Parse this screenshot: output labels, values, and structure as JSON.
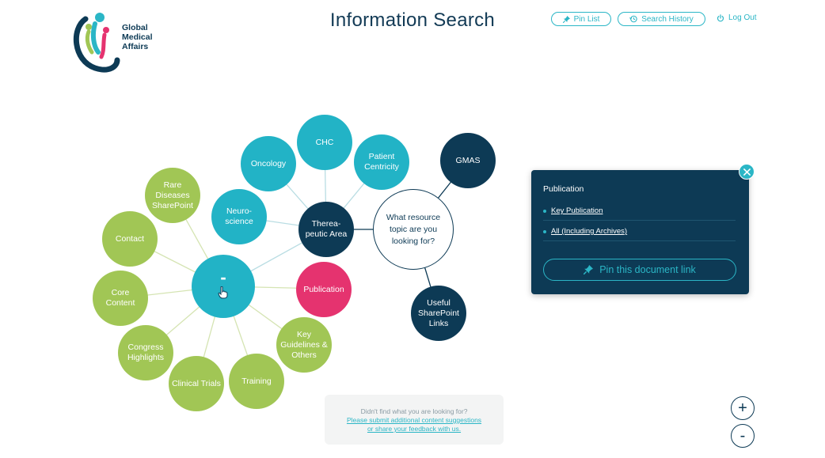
{
  "header": {
    "title": "Information Search",
    "logo_lines": [
      "Global",
      "Medical",
      "Affairs"
    ],
    "pin_list_label": "Pin List",
    "search_history_label": "Search History",
    "logout_label": "Log Out"
  },
  "mindmap": {
    "center_question": "What resource topic are you looking for?",
    "active_node_label": "-",
    "nodes": {
      "gmas": "GMAS",
      "useful_sharepoint": "Useful SharePoint Links",
      "therapeutic_area": "Therea-peutic Area",
      "chc": "CHC",
      "oncology": "Oncology",
      "patient_centricity": "Patient Centricity",
      "neuroscience": "Neuro-science",
      "publication": "Publication",
      "key_guidelines": "Key Guidelines & Others",
      "training": "Training",
      "clinical_trials": "Clinical Trials",
      "congress_highlights": "Congress Highlights",
      "core_content": "Core Content",
      "contact": "Contact",
      "rare_diseases": "Rare Diseases SharePoint"
    }
  },
  "panel": {
    "heading": "Publication",
    "links": [
      "Key Publication",
      "All (Including Archives)"
    ],
    "pin_button_label": "Pin this document link"
  },
  "feedback": {
    "question": "Didn't find what you are looking for?",
    "link_line1": "Please submit additional content suggestions",
    "link_line2": "or share your feedback with us."
  },
  "zoom": {
    "in_label": "+",
    "out_label": "-"
  },
  "colors": {
    "teal": "#22b3c6",
    "navy": "#0d3a55",
    "green": "#a1c655",
    "pink": "#e5336f"
  }
}
